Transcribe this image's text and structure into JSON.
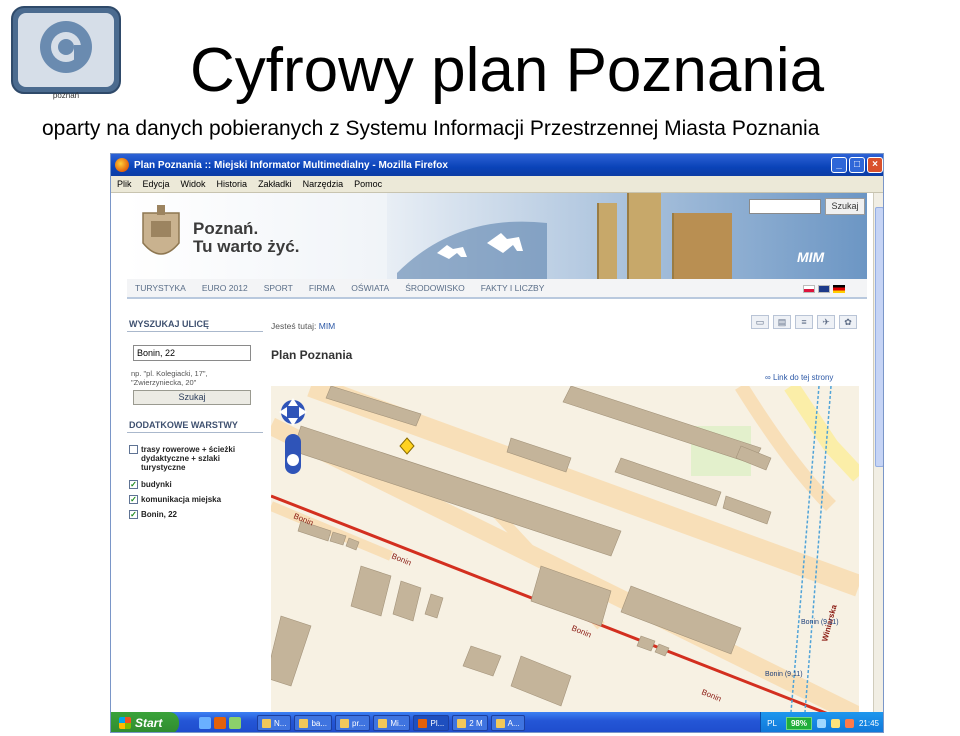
{
  "slide": {
    "title": "Cyfrowy plan Poznania",
    "subtitle": "oparty na danych pobieranych z Systemu Informacji Przestrzennej Miasta Poznania",
    "logo_text": "poznań",
    "logo_icon": "at-sign-icon"
  },
  "window": {
    "title": "Plan Poznania :: Miejski Informator Multimedialny - Mozilla Firefox",
    "menu": [
      "Plik",
      "Edycja",
      "Widok",
      "Historia",
      "Zakładki",
      "Narzędzia",
      "Pomoc"
    ],
    "controls": {
      "minimize": "_",
      "maximize": "□",
      "close": "×"
    }
  },
  "site": {
    "brand_line1": "Poznań.",
    "brand_line2": "Tu warto żyć.",
    "mim_logo": "MIM",
    "search_button": "Szukaj",
    "nav": [
      "TURYSTYKA",
      "EURO 2012",
      "SPORT",
      "FIRMA",
      "OŚWIATA",
      "ŚRODOWISKO",
      "FAKTY I LICZBY"
    ],
    "flags": [
      "pl",
      "gb",
      "de"
    ]
  },
  "left_panel": {
    "search_heading": "WYSZUKAJ ULICĘ",
    "street_value": "Bonin, 22",
    "street_hint": "np. \"pl. Kolegiacki, 17\", \"Zwierzyniecka, 20\"",
    "search_button": "Szukaj",
    "layers_heading": "DODATKOWE WARSTWY",
    "layers": [
      {
        "label": "trasy rowerowe + ścieżki dydaktyczne + szlaki turystyczne",
        "checked": false
      },
      {
        "label": "budynki",
        "checked": true
      },
      {
        "label": "komunikacja miejska",
        "checked": true
      },
      {
        "label": "Bonin, 22",
        "checked": true
      }
    ]
  },
  "content": {
    "breadcrumb_prefix": "Jesteś tutaj:",
    "breadcrumb_link": "MIM",
    "heading": "Plan Poznania",
    "link_to_page": "Link do tej strony",
    "tools": [
      "bus-icon",
      "print-icon",
      "rail-icon",
      "plane-icon",
      "settings-icon"
    ]
  },
  "map": {
    "street_labels": [
      "Bonin",
      "Bonin",
      "Bonin",
      "Bonin",
      "Winiarska"
    ],
    "stop_labels": [
      "Bonin (9,11)",
      "Bonin (9,11)"
    ]
  },
  "taskbar": {
    "start": "Start",
    "tasks": [
      "N...",
      "ba...",
      "pr...",
      "Mi...",
      "Pl...",
      "2 M",
      "A..."
    ],
    "language": "PL",
    "battery": "98%",
    "clock": "21:45"
  },
  "colors": {
    "titlebar": "#0a43b8",
    "road_main": "#d32f1f",
    "road_light": "#f8dfb8",
    "building": "#c4b49a",
    "map_bg": "#f7f1e3",
    "nav_text": "#5a6e88"
  }
}
